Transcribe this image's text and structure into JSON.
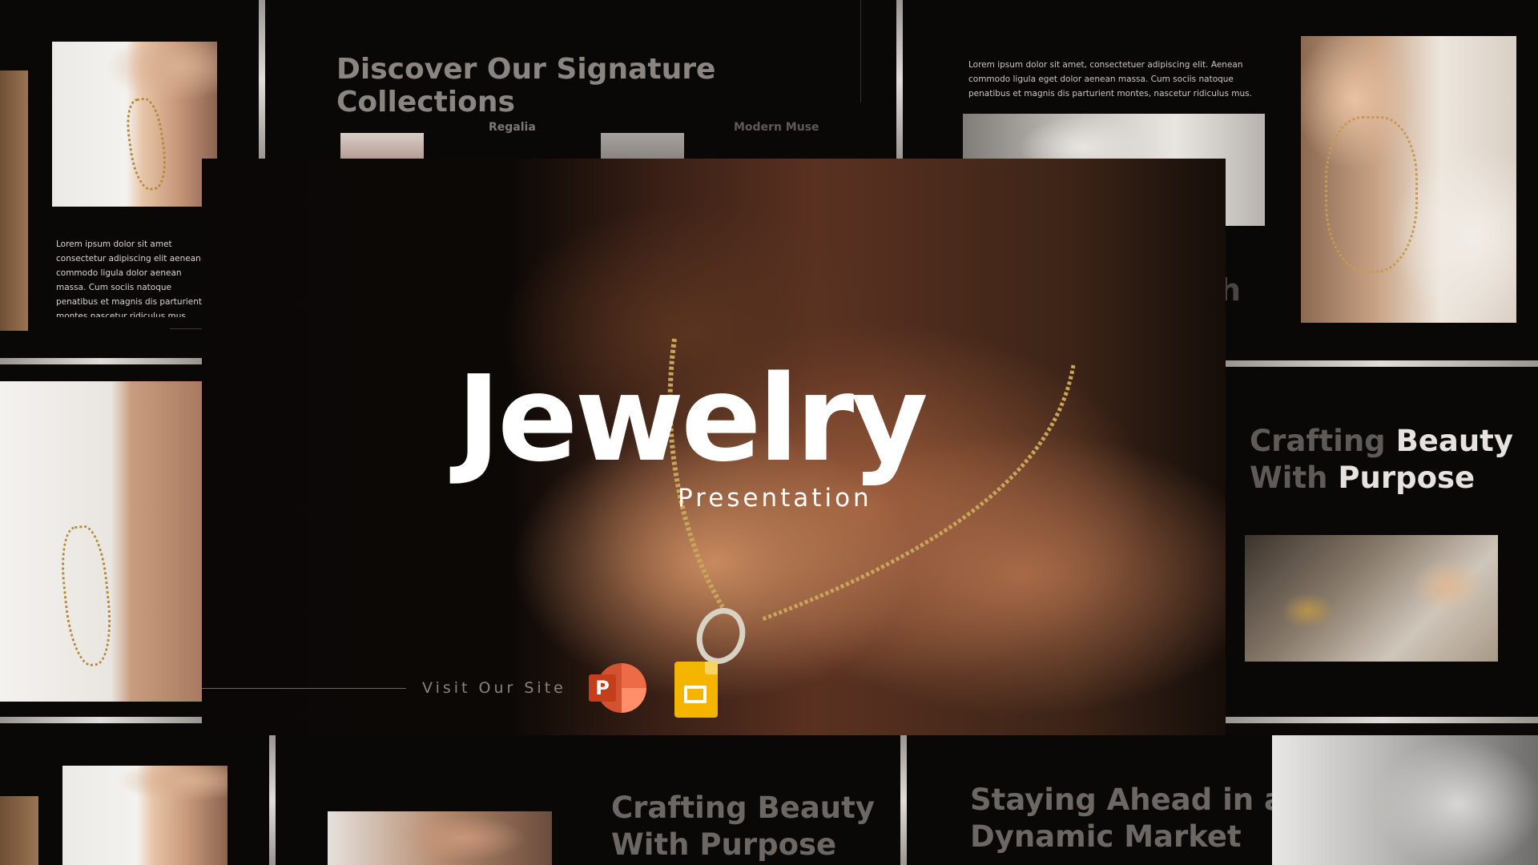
{
  "hero": {
    "title": "Jewelry",
    "subtitle": "Presentation",
    "cta": "Visit Our Site",
    "app_icons": [
      "powerpoint-icon",
      "google-slides-icon"
    ],
    "powerpoint_letter": "P"
  },
  "slides": {
    "top_center": {
      "title": "Discover Our Signature Collections",
      "label_left": "Regalia",
      "label_right": "Modern Muse"
    },
    "top_right": {
      "body": "Lorem ipsum dolor sit amet, consectetuer adipiscing elit. Aenean commodo ligula eget dolor aenean massa. Cum sociis natoque penatibus et magnis dis parturient montes, nascetur ridiculus mus.",
      "partial_letter": "h"
    },
    "left_mid": {
      "body": "Lorem ipsum dolor sit amet consectetur adipiscing elit aenean commodo ligula dolor aenean massa. Cum sociis natoque penatibus et magnis dis parturient montes nascetur ridiculus mus."
    },
    "right_mid": {
      "title_line1_light": "Crafting",
      "title_line1_bold": "Beauty",
      "title_line2_light": "With",
      "title_line2_bold": "Purpose"
    },
    "bottom_center": {
      "title_line1": "Crafting Beauty",
      "title_line2": "With Purpose"
    },
    "bottom_right": {
      "title_line1": "Staying Ahead in a",
      "title_line2": "Dynamic Market"
    }
  },
  "colors": {
    "background": "#0b0807",
    "title_white": "#ffffff",
    "muted_text": "#6a6560",
    "gold": "#c9a45a",
    "powerpoint_red": "#d24726",
    "slides_yellow": "#f5b400"
  }
}
